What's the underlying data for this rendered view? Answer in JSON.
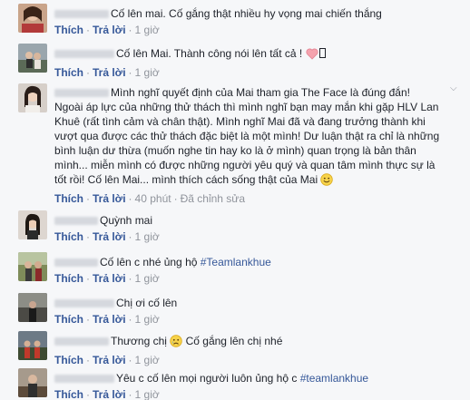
{
  "colors": {
    "link": "#365899",
    "meta": "#90949c",
    "background": "#f6f7f9"
  },
  "actions": {
    "like": "Thích",
    "reply": "Trả lời",
    "separator": "·",
    "edited": "Đã chỉnh sửa"
  },
  "comments": [
    {
      "text": "Cố lên mai. Cố gắng thật nhiều hy vọng mai chiến thắng",
      "time": "1 giờ"
    },
    {
      "text_before": "Cố lên Mai. Thành công nói lên tất cả !",
      "emoji": "heart-icon",
      "time": "1 giờ"
    },
    {
      "text_lines": [
        "Mình nghĩ quyết định của Mai tham gia The Face là đúng đắn!",
        "Ngoài áp lực của những thử thách thì mình nghĩ bạn may mắn khi gặp HLV Lan",
        "Khuê (rất tình cảm và chân thật). Mình nghĩ Mai đã và đang trưởng thành khi",
        "vượt qua được các thử thách đặc biệt là một mình! Dư luận thật ra chỉ là những",
        "bình luận dư thừa (muốn nghe tin hay ko là ở mình) quan trọng là bản thân",
        "mình... miễn mình có được những người yêu quý và quan tâm mình thực sự là",
        "tốt rồi! Cố lên Mai... mình thích cách sống thật của Mai"
      ],
      "emoji": "smile-icon",
      "time": "40 phút"
    },
    {
      "text": "Quỳnh mai",
      "time": "1 giờ"
    },
    {
      "text_before": "Cố lên c nhé ủng hộ ",
      "hashtag": "#Teamlankhue",
      "time": "1 giờ"
    },
    {
      "text": "Chị ơi cố lên",
      "time": "1 giờ"
    },
    {
      "text_before": "Thương chị",
      "emoji": "crying-face-icon",
      "text_after": " Cố gắng lên chị nhé",
      "time": "1 giờ"
    },
    {
      "text_before": "Yêu c cố lên mọi người luôn ủng hộ c ",
      "hashtag": "#teamlankhue",
      "time": "1 giờ"
    }
  ]
}
